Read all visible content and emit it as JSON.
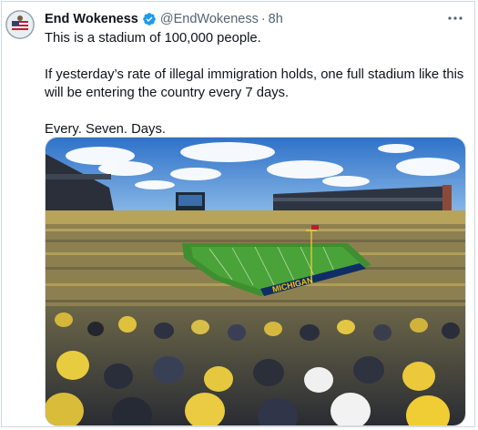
{
  "post": {
    "display_name": "End Wokeness",
    "handle": "@EndWokeness",
    "separator": "·",
    "time": "8h",
    "text_lines": [
      "This is a stadium of 100,000 people.",
      "If yesterday’s rate of illegal immigration holds, one full stadium like this will be entering the country every 7 days.",
      "Every. Seven. Days."
    ],
    "icons": {
      "verified": "verified-badge-icon",
      "more": "more-options-icon"
    },
    "colors": {
      "verified_blue": "#1d9bf0",
      "secondary_text": "#536471",
      "border": "#cfd9de"
    }
  },
  "media": {
    "field_end_zone_text": "MICHIGAN"
  }
}
